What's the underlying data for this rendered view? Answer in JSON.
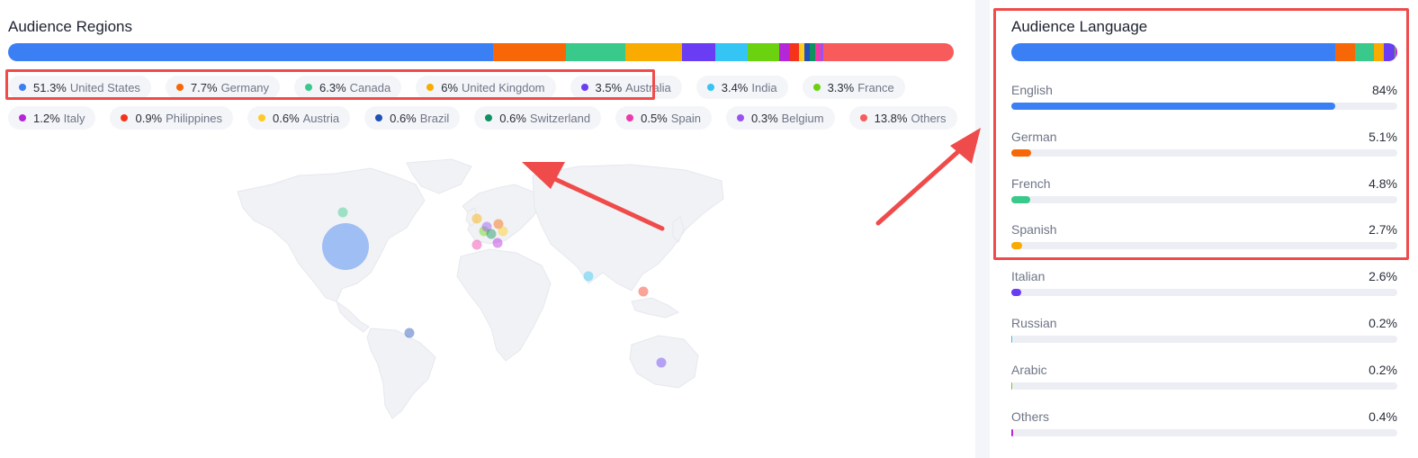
{
  "regions": {
    "title": "Audience Regions",
    "items": [
      {
        "pct": "51.3%",
        "name": "United States",
        "color": "#3b7ff5",
        "value": 51.3
      },
      {
        "pct": "7.7%",
        "name": "Germany",
        "color": "#f76707",
        "value": 7.7
      },
      {
        "pct": "6.3%",
        "name": "Canada",
        "color": "#38c98b",
        "value": 6.3
      },
      {
        "pct": "6%",
        "name": "United Kingdom",
        "color": "#f9ab00",
        "value": 6.0
      },
      {
        "pct": "3.5%",
        "name": "Australia",
        "color": "#6a3df5",
        "value": 3.5
      },
      {
        "pct": "3.4%",
        "name": "India",
        "color": "#35c5f5",
        "value": 3.4
      },
      {
        "pct": "3.3%",
        "name": "France",
        "color": "#6bd20f",
        "value": 3.3
      },
      {
        "pct": "1.2%",
        "name": "Italy",
        "color": "#b626d9",
        "value": 1.2
      },
      {
        "pct": "0.9%",
        "name": "Philippines",
        "color": "#f5331b",
        "value": 0.9
      },
      {
        "pct": "0.6%",
        "name": "Austria",
        "color": "#fdcb22",
        "value": 0.6
      },
      {
        "pct": "0.6%",
        "name": "Brazil",
        "color": "#2050b8",
        "value": 0.6
      },
      {
        "pct": "0.6%",
        "name": "Switzerland",
        "color": "#0f9160",
        "value": 0.6
      },
      {
        "pct": "0.5%",
        "name": "Spain",
        "color": "#ee3aa6",
        "value": 0.5
      },
      {
        "pct": "0.3%",
        "name": "Belgium",
        "color": "#9a52f5",
        "value": 0.3
      },
      {
        "pct": "13.8%",
        "name": "Others",
        "color": "#f75b5b",
        "value": 13.8
      }
    ]
  },
  "languages": {
    "title": "Audience Language",
    "items": [
      {
        "name": "English",
        "pct": "84%",
        "value": 84,
        "color": "#3b7ff5"
      },
      {
        "name": "German",
        "pct": "5.1%",
        "value": 5.1,
        "color": "#f76707"
      },
      {
        "name": "French",
        "pct": "4.8%",
        "value": 4.8,
        "color": "#38c98b"
      },
      {
        "name": "Spanish",
        "pct": "2.7%",
        "value": 2.7,
        "color": "#f9ab00"
      },
      {
        "name": "Italian",
        "pct": "2.6%",
        "value": 2.6,
        "color": "#6a3df5"
      },
      {
        "name": "Russian",
        "pct": "0.2%",
        "value": 0.2,
        "color": "#35c5f5"
      },
      {
        "name": "Arabic",
        "pct": "0.2%",
        "value": 0.2,
        "color": "#6bd20f"
      },
      {
        "name": "Others",
        "pct": "0.4%",
        "value": 0.4,
        "color": "#b626d9"
      }
    ]
  },
  "annotation_color": "#ef4b4b",
  "map_icon": "world-map"
}
